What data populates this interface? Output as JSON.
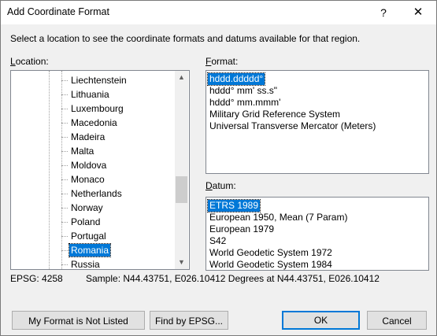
{
  "window": {
    "title": "Add Coordinate Format",
    "help_label": "?",
    "close_label": "✕"
  },
  "instruction": "Select a location to see the coordinate formats and datums available for that region.",
  "location": {
    "label_accel": "L",
    "label_rest": "ocation:",
    "items": [
      "Liechtenstein",
      "Lithuania",
      "Luxembourg",
      "Macedonia",
      "Madeira",
      "Malta",
      "Moldova",
      "Monaco",
      "Netherlands",
      "Norway",
      "Poland",
      "Portugal",
      "Romania",
      "Russia"
    ],
    "selected": "Romania",
    "scroll_up": "▲",
    "scroll_down": "▼"
  },
  "format": {
    "label_accel": "F",
    "label_rest": "ormat:",
    "items": [
      "hddd.ddddd°",
      "hddd° mm' ss.s\"",
      "hddd° mm.mmm'",
      "Military Grid Reference System",
      "Universal Transverse Mercator (Meters)"
    ],
    "selected": "hddd.ddddd°"
  },
  "datum": {
    "label_accel": "D",
    "label_rest": "atum:",
    "items": [
      "ETRS 1989",
      "European 1950, Mean (7 Param)",
      "European 1979",
      "S42",
      "World Geodetic System 1972",
      "World Geodetic System 1984"
    ],
    "selected": "ETRS 1989"
  },
  "status": {
    "epsg": "EPSG: 4258",
    "sample": "Sample: N44.43751, E026.10412 Degrees at N44.43751, E026.10412"
  },
  "buttons": {
    "not_listed": "My Format is Not Listed",
    "find_epsg": "Find by EPSG...",
    "ok": "OK",
    "cancel": "Cancel"
  }
}
